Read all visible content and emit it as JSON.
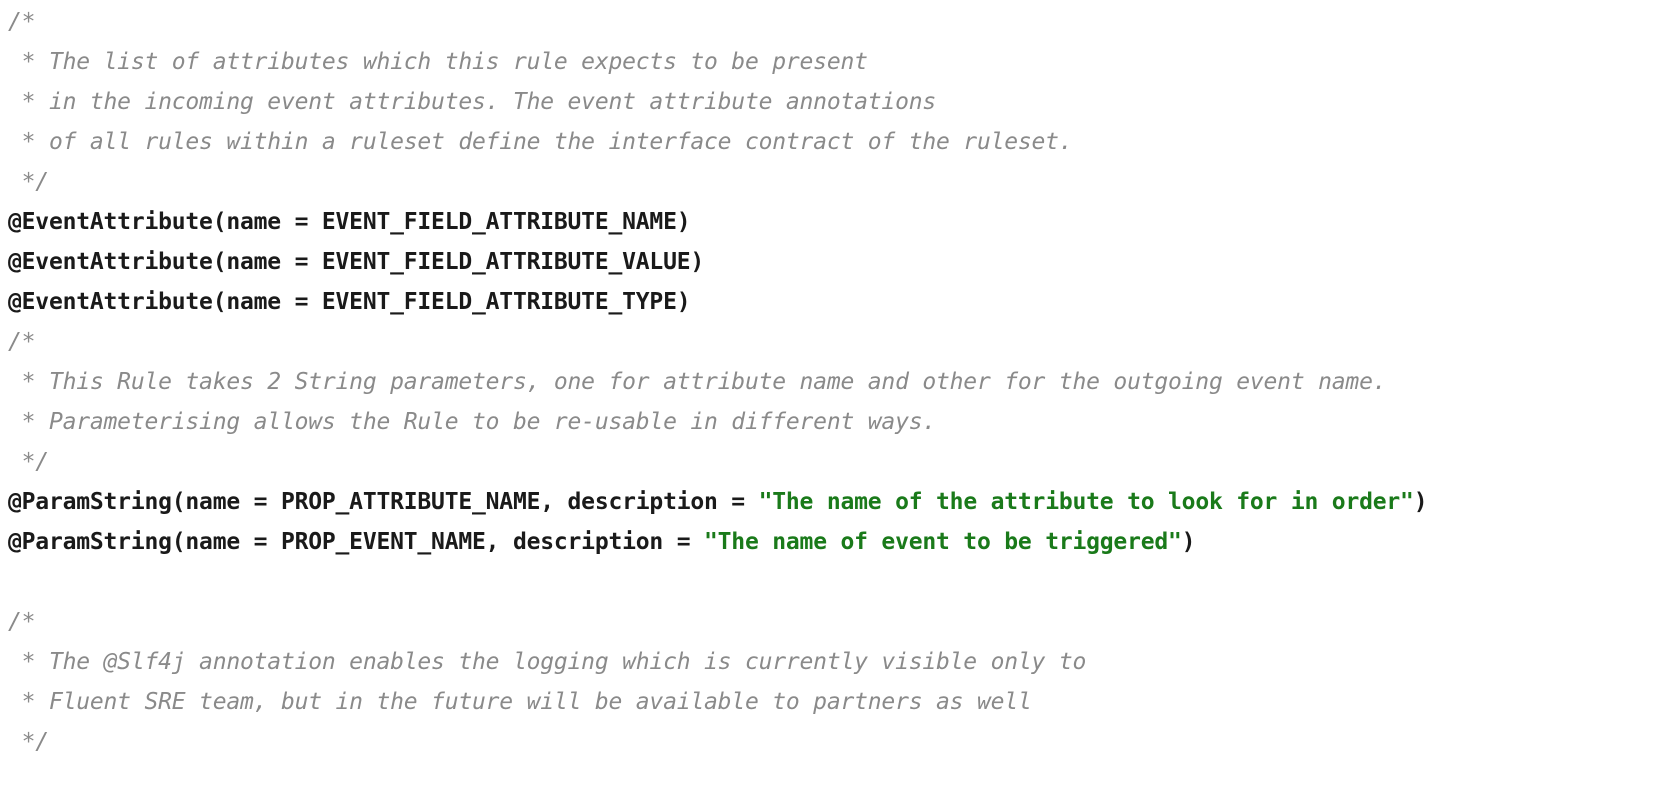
{
  "editor": {
    "language": "java",
    "background_color": "#ffffff",
    "comment_color": "#8a8a8a",
    "code_color": "#1a1a1a",
    "string_color": "#1a7a1a",
    "font_size_px": 23,
    "line_height_px": 40,
    "total_lines": 20
  },
  "lines": [
    {
      "index": 1,
      "type": "comment",
      "tokens": [
        {
          "kind": "comment",
          "text": "/*"
        }
      ]
    },
    {
      "index": 2,
      "type": "comment",
      "tokens": [
        {
          "kind": "comment",
          "text": " * The list of attributes which this rule expects to be present"
        }
      ]
    },
    {
      "index": 3,
      "type": "comment",
      "tokens": [
        {
          "kind": "comment",
          "text": " * in the incoming event attributes. The event attribute annotations"
        }
      ]
    },
    {
      "index": 4,
      "type": "comment",
      "tokens": [
        {
          "kind": "comment",
          "text": " * of all rules within a ruleset define the interface contract of the ruleset."
        }
      ]
    },
    {
      "index": 5,
      "type": "comment",
      "tokens": [
        {
          "kind": "comment",
          "text": " */"
        }
      ]
    },
    {
      "index": 6,
      "type": "annotation",
      "tokens": [
        {
          "kind": "code",
          "text": "@EventAttribute(name = EVENT_FIELD_ATTRIBUTE_NAME)"
        }
      ]
    },
    {
      "index": 7,
      "type": "annotation",
      "tokens": [
        {
          "kind": "code",
          "text": "@EventAttribute(name = EVENT_FIELD_ATTRIBUTE_VALUE)"
        }
      ]
    },
    {
      "index": 8,
      "type": "annotation",
      "tokens": [
        {
          "kind": "code",
          "text": "@EventAttribute(name = EVENT_FIELD_ATTRIBUTE_TYPE)"
        }
      ]
    },
    {
      "index": 9,
      "type": "comment",
      "tokens": [
        {
          "kind": "comment",
          "text": "/*"
        }
      ]
    },
    {
      "index": 10,
      "type": "comment",
      "tokens": [
        {
          "kind": "comment",
          "text": " * This Rule takes 2 String parameters, one for attribute name and other for the outgoing event name."
        }
      ]
    },
    {
      "index": 11,
      "type": "comment",
      "tokens": [
        {
          "kind": "comment",
          "text": " * Parameterising allows the Rule to be re-usable in different ways."
        }
      ]
    },
    {
      "index": 12,
      "type": "comment",
      "tokens": [
        {
          "kind": "comment",
          "text": " */"
        }
      ]
    },
    {
      "index": 13,
      "type": "annotation",
      "tokens": [
        {
          "kind": "code",
          "text": "@ParamString(name = PROP_ATTRIBUTE_NAME, description = "
        },
        {
          "kind": "string",
          "text": "\"The name of the attribute to look for in order\""
        },
        {
          "kind": "code",
          "text": ")"
        }
      ]
    },
    {
      "index": 14,
      "type": "annotation",
      "tokens": [
        {
          "kind": "code",
          "text": "@ParamString(name = PROP_EVENT_NAME, description = "
        },
        {
          "kind": "string",
          "text": "\"The name of event to be triggered\""
        },
        {
          "kind": "code",
          "text": ")"
        }
      ]
    },
    {
      "index": 15,
      "type": "blank",
      "tokens": []
    },
    {
      "index": 16,
      "type": "comment",
      "tokens": [
        {
          "kind": "comment",
          "text": "/*"
        }
      ]
    },
    {
      "index": 17,
      "type": "comment",
      "tokens": [
        {
          "kind": "comment",
          "text": " * The @Slf4j annotation enables the logging which is currently visible only to"
        }
      ]
    },
    {
      "index": 18,
      "type": "comment",
      "tokens": [
        {
          "kind": "comment",
          "text": " * Fluent SRE team, but in the future will be available to partners as well"
        }
      ]
    },
    {
      "index": 19,
      "type": "comment",
      "tokens": [
        {
          "kind": "comment",
          "text": " */"
        }
      ]
    },
    {
      "index": 20,
      "type": "blank",
      "tokens": []
    }
  ]
}
